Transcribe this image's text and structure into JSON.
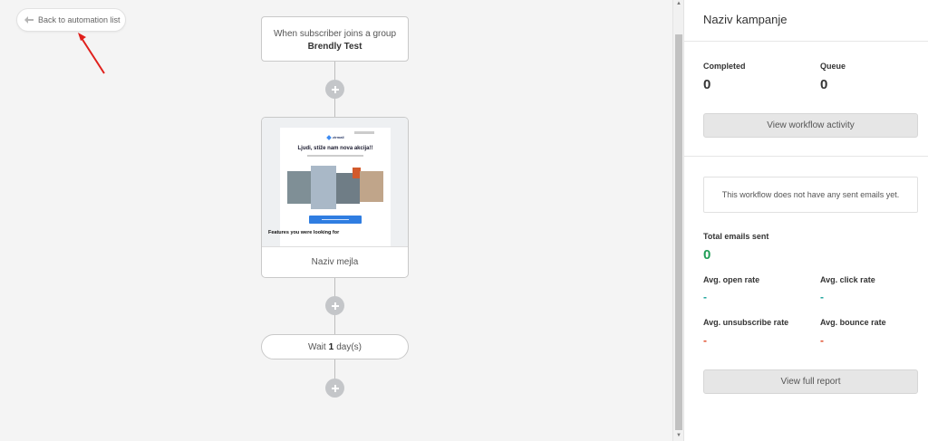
{
  "back_button": {
    "label": "Back to automation list"
  },
  "trigger": {
    "line1": "When subscriber joins a group",
    "group": "Brendly Test"
  },
  "email": {
    "name": "Naziv mejla",
    "preview": {
      "logo": "zirmail",
      "headline": "Ljudi, stiže nam nova akcija!!",
      "features_heading": "Features you were looking for"
    }
  },
  "wait": {
    "prefix": "Wait",
    "amount": "1",
    "unit": "day(s)"
  },
  "panel": {
    "title": "Naziv kampanje",
    "completed_label": "Completed",
    "completed_value": "0",
    "queue_label": "Queue",
    "queue_value": "0",
    "view_activity_label": "View workflow activity",
    "no_emails_message": "This workflow does not have any sent emails yet.",
    "total_sent_label": "Total emails sent",
    "total_sent_value": "0",
    "open_rate_label": "Avg. open rate",
    "open_rate_value": "-",
    "click_rate_label": "Avg. click rate",
    "click_rate_value": "-",
    "unsub_rate_label": "Avg. unsubscribe rate",
    "unsub_rate_value": "-",
    "bounce_rate_label": "Avg. bounce rate",
    "bounce_rate_value": "-",
    "view_report_label": "View full report"
  },
  "colors": {
    "green": "#1f9d55",
    "teal": "#1aa39a",
    "red": "#e04b2a",
    "annotation": "#e0201c"
  }
}
